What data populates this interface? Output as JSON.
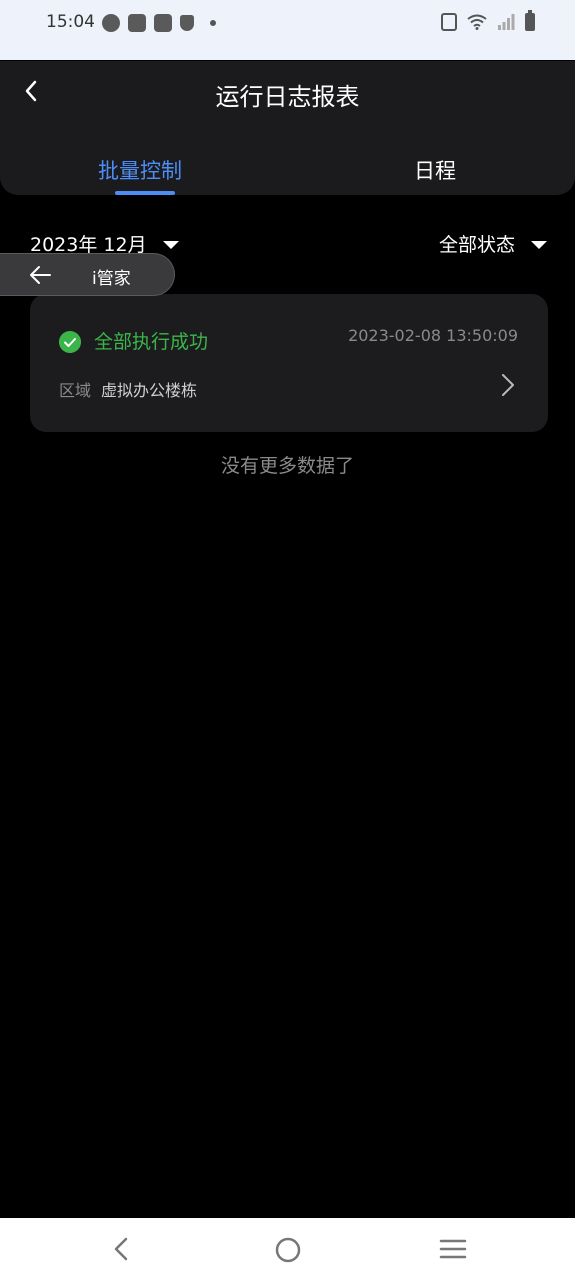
{
  "status_bar": {
    "time": "15:04"
  },
  "header": {
    "title": "运行日志报表",
    "tabs": [
      {
        "label": "批量控制",
        "active": true
      },
      {
        "label": "日程",
        "active": false
      }
    ]
  },
  "filters": {
    "date": "2023年 12月",
    "status": "全部状态"
  },
  "floating_return": {
    "label": "i管家"
  },
  "records": [
    {
      "status": "全部执行成功",
      "timestamp": "2023-02-08 13:50:09",
      "area_label": "区域",
      "area_value": "虚拟办公楼栋"
    }
  ],
  "list_footer": "没有更多数据了",
  "colors": {
    "accent": "#4C8DF6",
    "success": "#3BB54A",
    "muted": "#8A8A8A",
    "panel": "#1B1B1D",
    "card": "#1C1C1E"
  }
}
